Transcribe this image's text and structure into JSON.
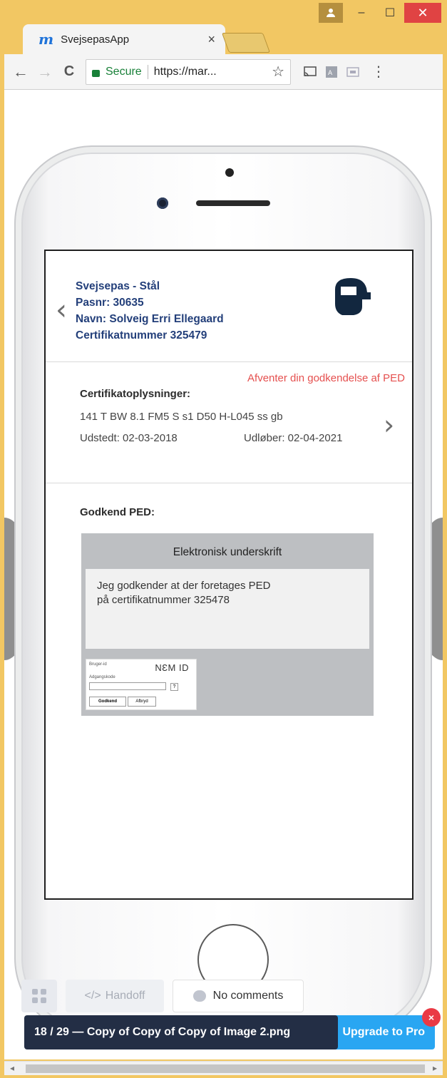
{
  "window": {
    "user_icon": "person-icon",
    "minimize": "–",
    "maximize": "☐",
    "close": "✕"
  },
  "tab": {
    "favicon": "m",
    "title": "SvejsepasApp",
    "close": "×"
  },
  "toolbar": {
    "back": "←",
    "forward": "→",
    "reload": "C",
    "secure_label": "Secure",
    "url": "https://mar...",
    "bookmark": "☆",
    "menu": "⋮"
  },
  "app": {
    "header": {
      "title": "Svejsepas - Stål",
      "pasnr": "Pasnr: 30635",
      "name": "Navn: Solveig Erri Ellegaard",
      "certificate": "Certifikatnummer 325479",
      "back": "‹"
    },
    "certificate": {
      "status": "Afventer din godkendelse af PED",
      "title": "Certifikatoplysninger:",
      "code": "141 T BW 8.1 FM5 S s1 D50 H-L045 ss gb",
      "issued": "Udstedt: 02-03-2018",
      "expires": "Udløber: 02-04-2021",
      "next": "›"
    },
    "approve": {
      "title": "Godkend PED:",
      "signature_title": "Elektronisk underskrift",
      "line1": "Jeg godkender at der foretages PED",
      "line2": "på certifikatnummer 325478",
      "nemid": {
        "user_label": "Bruger-id",
        "password_label": "Adgangskode",
        "logo": "NƐM ID",
        "help": "?",
        "approve_button": "Godkend",
        "cancel_button": "Afbryd"
      }
    }
  },
  "viewer": {
    "handoff": "Handoff",
    "handoff_icon": "</>",
    "comments": "No comments",
    "file_label": "18 / 29 — Copy of Copy of Copy of Image 2.png",
    "upgrade": "Upgrade to Pro",
    "upgrade_close": "×"
  },
  "scrollbar": {
    "left": "◂",
    "right": "▸"
  },
  "colors": {
    "chrome_frame": "#f2c763",
    "brand_blue": "#233f7a",
    "status_red": "#e5504f",
    "upgrade_blue": "#29a6f2",
    "file_bar": "#232e45"
  }
}
